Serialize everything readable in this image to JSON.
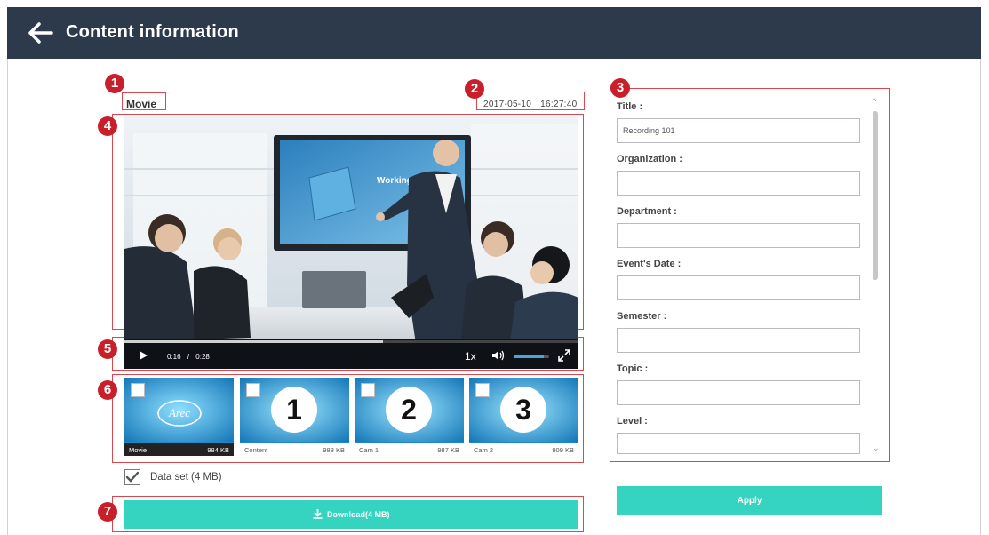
{
  "header": {
    "title": "Content information"
  },
  "callouts": [
    "1",
    "2",
    "3",
    "4",
    "5",
    "6",
    "7"
  ],
  "content": {
    "type_label": "Movie",
    "date": "2017-05-10",
    "time": "16:27:40"
  },
  "video": {
    "screen_text": "Working Capital",
    "current_time": "0:16",
    "separator": "/",
    "duration": "0:28",
    "progress": 0.57,
    "speed": "1x",
    "volume": 0.85
  },
  "thumbnails": [
    {
      "art": "Arec",
      "name": "Movie",
      "size": "984 KB",
      "checked": false
    },
    {
      "art": "1",
      "name": "Content",
      "size": "988 KB",
      "checked": false
    },
    {
      "art": "2",
      "name": "Cam 1",
      "size": "987 KB",
      "checked": false
    },
    {
      "art": "3",
      "name": "Cam 2",
      "size": "909 KB",
      "checked": false
    }
  ],
  "dataset": {
    "label": "Data set (4 MB)",
    "checked": true
  },
  "download": {
    "label": "Download(4 MB)"
  },
  "form": {
    "fields": [
      {
        "label": "Title :",
        "value": "Recording 101"
      },
      {
        "label": "Organization :",
        "value": ""
      },
      {
        "label": "Department :",
        "value": ""
      },
      {
        "label": "Event's Date :",
        "value": ""
      },
      {
        "label": "Semester :",
        "value": ""
      },
      {
        "label": "Topic :",
        "value": ""
      },
      {
        "label": "Level :",
        "value": ""
      }
    ]
  },
  "apply": {
    "label": "Apply"
  },
  "colors": {
    "header": "#2c3a4b",
    "accent": "#35d4c0",
    "callout": "#c8202b"
  }
}
